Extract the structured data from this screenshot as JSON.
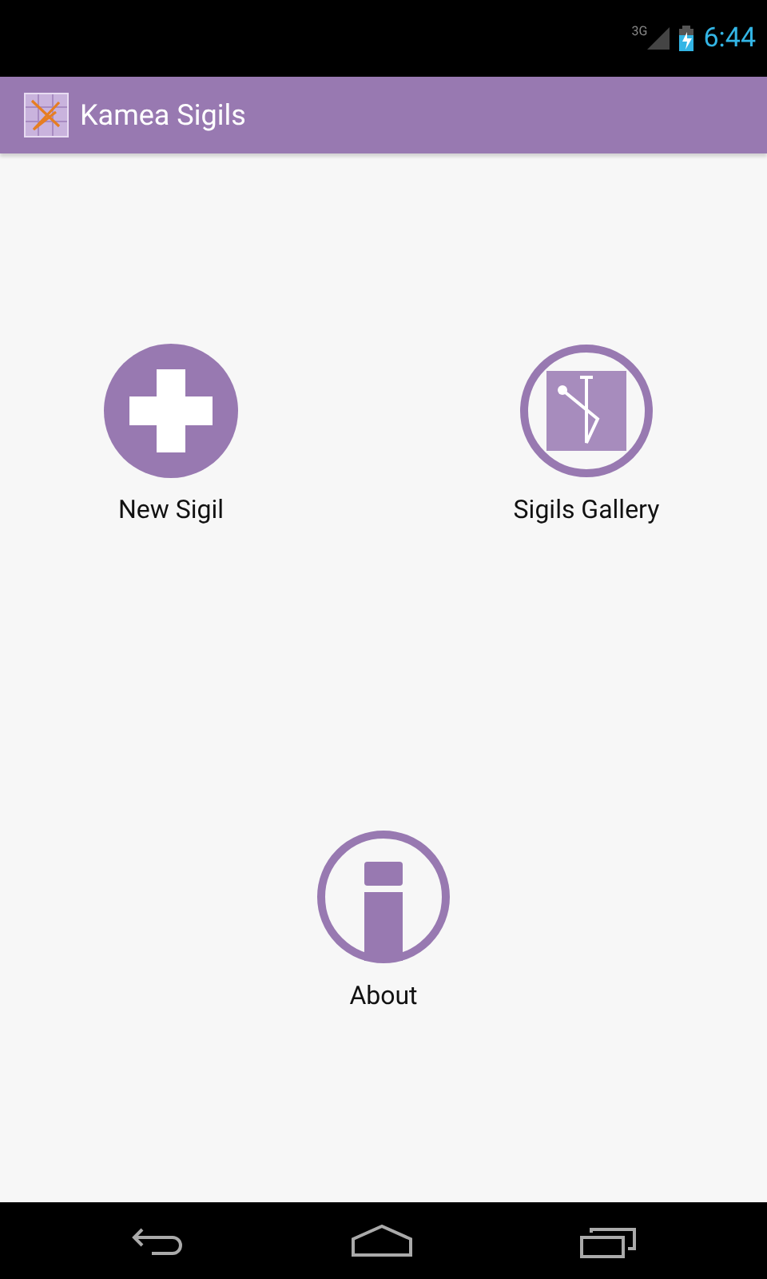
{
  "status_bar": {
    "network": "3G",
    "time": "6:44"
  },
  "app_bar": {
    "title": "Kamea Sigils"
  },
  "menu": [
    {
      "kind": "plus",
      "label": "New Sigil"
    },
    {
      "kind": "gallery",
      "label": "Sigils Gallery"
    },
    {
      "kind": "info",
      "label": "About"
    }
  ]
}
